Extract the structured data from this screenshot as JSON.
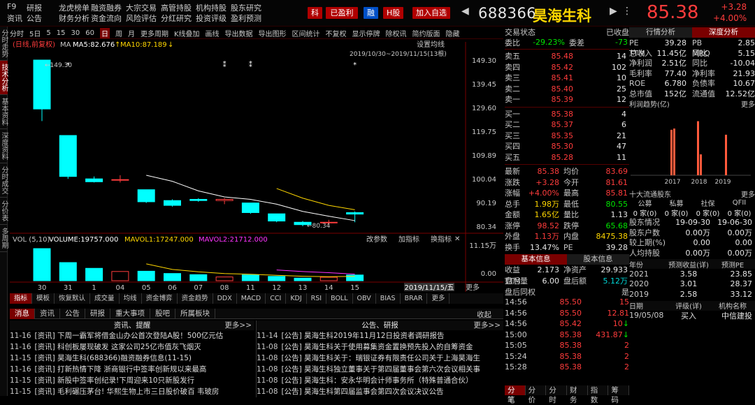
{
  "topnav": [
    [
      "F9",
      "研报",
      "龙虎榜单",
      "融资融券",
      "大宗交易",
      "高管持股",
      "机构持股",
      "股东研究"
    ],
    [
      "资讯",
      "公告",
      "财务分析",
      "资金流向",
      "风险评估",
      "分红研究",
      "投资评级",
      "盈利预测"
    ]
  ],
  "badges": {
    "ke": "科",
    "profit": "已盈利",
    "rong": "融",
    "h": "H股",
    "add": "加入自选"
  },
  "stock": {
    "code": "688366",
    "name": "昊海生科",
    "price": "85.38",
    "change": "+3.28",
    "pct": "+4.00%"
  },
  "left_tabs": [
    "分时走势",
    "技术分析",
    "基本资料",
    "深度资料",
    "分时成交",
    "分价表",
    "多周期"
  ],
  "chart_toolbar": [
    "分时",
    "5日",
    "5",
    "15",
    "30",
    "60",
    "日",
    "周",
    "月",
    "更多周期",
    "K线叠加",
    "画线",
    "导出数据",
    "导出图形",
    "区间统计",
    "不复权",
    "显示停牌",
    "除权讯",
    "简约版面",
    "隐藏"
  ],
  "chart_labels": {
    "adj": "(日线,前复权)",
    "ma": "MA",
    "ma5": "MA5:82.676",
    "ma10": "MA10:87.189",
    "setting": "设置均线",
    "range": "2019/10/30~2019/11/15(13根)",
    "high_label": "149.30",
    "low_label": "80.34",
    "vol": "VOL (5,10)",
    "volume": "VOLUME:19757.000",
    "mavol1": "MAVOL1:17247.000",
    "mavol2": "MAVOL2:21712.000",
    "vol_btns": [
      "改参数",
      "加指标",
      "换指标"
    ],
    "vol_axis": [
      "11.15万",
      "0.00"
    ],
    "date_box": "2019/11/15/五",
    "more": "更多"
  },
  "chart_data": {
    "type": "candlestick",
    "x": [
      "10/30",
      "10/31",
      "11/01",
      "11/04",
      "11/05",
      "11/06",
      "11/07",
      "11/08",
      "11/11",
      "11/12",
      "11/13",
      "11/14",
      "11/15"
    ],
    "x_tick_labels": [
      "30",
      "31",
      "1",
      "04",
      "05",
      "06",
      "07",
      "08",
      "11",
      "12",
      "13",
      "14",
      "15"
    ],
    "open": [
      149.3,
      118.0,
      100.0,
      99.6,
      95.5,
      91.0,
      91.5,
      91.0,
      90.0,
      85.5,
      82.0,
      82.0,
      86.0
    ],
    "high": [
      149.3,
      118.0,
      101.0,
      101.5,
      95.5,
      91.5,
      92.0,
      92.0,
      90.0,
      85.5,
      82.5,
      83.0,
      86.5
    ],
    "low": [
      124.0,
      100.0,
      98.5,
      98.5,
      90.0,
      88.5,
      90.5,
      89.5,
      85.5,
      82.0,
      80.34,
      80.5,
      82.0
    ],
    "close": [
      129.0,
      101.0,
      98.8,
      99.7,
      90.5,
      89.0,
      91.0,
      91.5,
      86.0,
      82.5,
      81.0,
      82.0,
      85.38
    ],
    "volume": [
      11.15,
      6.3,
      4.3,
      3.2,
      3.3,
      2.5,
      2.1,
      1.3,
      2.0,
      1.5,
      0.9,
      1.2,
      1.98
    ],
    "volume_unit": "万",
    "ma5": [
      null,
      null,
      null,
      null,
      101.5,
      99.0,
      95.0,
      92.5,
      91.5,
      89.5,
      86.5,
      84.5,
      82.676
    ],
    "ma10": [
      null,
      null,
      null,
      null,
      null,
      null,
      null,
      null,
      null,
      96.0,
      92.0,
      89.0,
      87.189
    ],
    "ylim": [
      80.34,
      149.3
    ],
    "y_ticks": [
      "149.30",
      "139.45",
      "129.60",
      "119.75",
      "109.89",
      "100.04",
      "90.19",
      "80.34"
    ],
    "colors": {
      "up": "#ff3c3c",
      "down": "#00ffff",
      "ma5": "#ffffff",
      "ma10": "#ffd700",
      "mavol2": "#ff33ff"
    }
  },
  "indicator_tabs": [
    "指标",
    "模板",
    "恢复默认",
    "成交量",
    "均线",
    "资金博弈",
    "资金趋势",
    "DDX",
    "MACD",
    "CCI",
    "KDJ",
    "RSI",
    "BOLL",
    "OBV",
    "BIAS",
    "BRAR",
    "更多"
  ],
  "news_tabs": [
    "消息",
    "资讯",
    "公告",
    "研报",
    "重大事项",
    "股吧",
    "所属板块"
  ],
  "news_tabs_right": "收起",
  "news_left": {
    "title": "资讯、提醒",
    "more": "更多>>",
    "items": [
      [
        "11-16",
        "[资讯] 下周一霸军将借金山办公首次登陆A股！500亿元估"
      ],
      [
        "11-16",
        "[资讯] 科创板屡现破发 这家公司25亿市值灰飞烟灭"
      ],
      [
        "11-15",
        "[资讯] 昊海生科(688366)融资融券信息(11-15)"
      ],
      [
        "11-16",
        "[资讯] 打新热情下降 浙商银行中签率创新规以来最高"
      ],
      [
        "11-15",
        "[资讯] 新股中签率创纪录!下周迎来10只新股发行"
      ],
      [
        "11-15",
        "[资讯] 毛利碾压茅台! 华熙生物上市三日股价破百 韦玻房"
      ]
    ]
  },
  "news_right": {
    "title": "公告、研报",
    "more": "更多>>",
    "items": [
      [
        "11-14",
        "[公告] 昊海生科2019年11月12日投资者调研报告"
      ],
      [
        "11-08",
        "[公告] 昊海生科关于使用募集资金置换预先投入的自筹资金"
      ],
      [
        "11-08",
        "[公告] 昊海生科关于：瑞银证券有限责任公司关于上海昊海生"
      ],
      [
        "11-08",
        "[公告] 昊海生科独立董事关于第四届董事会第六次会议相关事"
      ],
      [
        "11-08",
        "[公告] 昊海生科：安永华明会计师事务所（特殊普通合伙）"
      ],
      [
        "11-08",
        "[公告] 昊海生科第四届监事会第四次会议决议公告"
      ]
    ]
  },
  "orderbook": {
    "header": "交易状态",
    "status": "已收盘",
    "ratio_l": "委比",
    "ratio_v": "-29.23%",
    "diff_l": "委差",
    "diff_v": "-73",
    "sells": [
      [
        "卖五",
        "85.48",
        "14"
      ],
      [
        "卖四",
        "85.42",
        "102"
      ],
      [
        "卖三",
        "85.41",
        "10"
      ],
      [
        "卖二",
        "85.40",
        "25"
      ],
      [
        "卖一",
        "85.39",
        "12"
      ]
    ],
    "buys": [
      [
        "买一",
        "85.38",
        "4"
      ],
      [
        "买二",
        "85.37",
        "6"
      ],
      [
        "买三",
        "85.35",
        "21"
      ],
      [
        "买四",
        "85.30",
        "47"
      ],
      [
        "买五",
        "85.28",
        "11"
      ]
    ],
    "stats": [
      [
        "最新",
        "85.38",
        "均价",
        "83.69"
      ],
      [
        "涨跌",
        "+3.28",
        "今开",
        "81.61"
      ],
      [
        "涨幅",
        "+4.00%",
        "最高",
        "85.81"
      ],
      [
        "总手",
        "1.98万",
        "最低",
        "80.55"
      ],
      [
        "金额",
        "1.65亿",
        "量比",
        "1.13"
      ],
      [
        "涨停",
        "98.52",
        "跌停",
        "65.68"
      ],
      [
        "外盘",
        "1.13万",
        "内盘",
        "8475.38"
      ],
      [
        "换手",
        "13.47%",
        "PE TTM",
        "39.28"
      ]
    ],
    "info_tabs": [
      "基本信息",
      "股本信息"
    ],
    "info": [
      [
        "收益TTM",
        "2.173",
        "净资产",
        "29.933"
      ],
      [
        "盘后量",
        "6.00",
        "盘后额",
        "5.12万"
      ]
    ],
    "tick_title": "盘后同权",
    "tick_flag": "是",
    "ticks": [
      [
        "14:56",
        "85.50",
        "15",
        ""
      ],
      [
        "14:56",
        "85.50",
        "12.81",
        ""
      ],
      [
        "14:56",
        "85.42",
        "10",
        "down"
      ],
      [
        "15:00",
        "85.38",
        "431.87",
        "down"
      ],
      [
        "15:05",
        "85.38",
        "2",
        ""
      ],
      [
        "15:24",
        "85.38",
        "2",
        ""
      ],
      [
        "15:28",
        "85.38",
        "2",
        ""
      ]
    ],
    "bottom_tabs": [
      "分笔",
      "分价",
      "分时",
      "财务",
      "指数",
      "筹码"
    ]
  },
  "rpanel": {
    "tabs": [
      "行情分析",
      "深度分析"
    ],
    "fin": [
      [
        "PE TTM",
        "39.28",
        "PB MRQ",
        "2.85"
      ],
      [
        "总收入",
        "11.45亿",
        "同比",
        "5.15"
      ],
      [
        "净利润",
        "2.51亿",
        "同比",
        "-10.04"
      ],
      [
        "毛利率",
        "77.40",
        "净利率",
        "21.93"
      ],
      [
        "ROE",
        "6.780",
        "负债率",
        "10.67"
      ],
      [
        "总市值",
        "152亿",
        "流通值",
        "12.52亿"
      ]
    ],
    "trend_title": "利润趋势(亿)",
    "trend_more": "更多",
    "trend_years": [
      "2017",
      "2018",
      "2019"
    ],
    "trend_values": [
      3.7,
      3.8,
      4.4,
      1.7,
      3.3
    ],
    "holders_title": "十大流通股东",
    "holders_more": "更多",
    "holder_types": [
      "公募",
      "私募",
      "社保",
      "QFII"
    ],
    "holder_counts": [
      "0 家(0)",
      "0 家(0)",
      "0 家(0)",
      "0 家(0)"
    ],
    "holders_rows": [
      [
        "股东情况",
        "19-09-30",
        "19-06-30"
      ],
      [
        "股东户数",
        "0.00万",
        "0.00万"
      ],
      [
        "较上期(%)",
        "0.00",
        "0.00"
      ],
      [
        "人均持股",
        "0.00万",
        "0.00万"
      ]
    ],
    "profit_head": [
      "年份",
      "预测收益(详)",
      "预测PE"
    ],
    "profit_rows": [
      [
        "2021",
        "3.58",
        "23.85"
      ],
      [
        "2020",
        "3.01",
        "28.37"
      ],
      [
        "2019",
        "2.58",
        "33.12"
      ]
    ],
    "rating_head": [
      "日期",
      "评级(详)",
      "机构名称"
    ],
    "rating_rows": [
      [
        "19/05/08",
        "买入",
        "中信建投"
      ]
    ]
  }
}
